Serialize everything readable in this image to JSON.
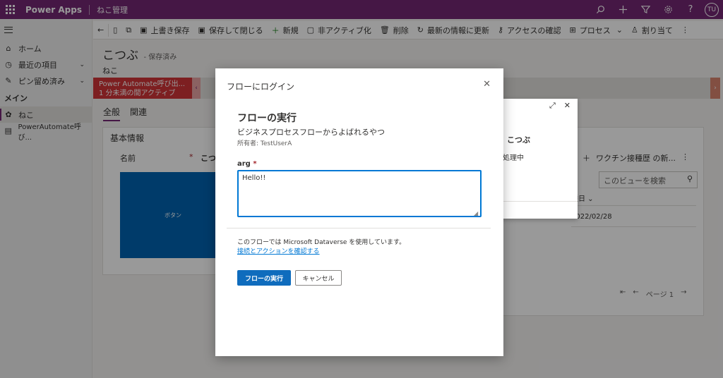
{
  "header": {
    "app_name": "Power Apps",
    "env_name": "ねこ管理",
    "avatar": "TU",
    "icons": [
      "search-icon",
      "plus-icon",
      "filter-icon",
      "gear-icon",
      "help-icon"
    ]
  },
  "nav": {
    "items": [
      {
        "label": "ホーム",
        "icon": "home-icon"
      },
      {
        "label": "最近の項目",
        "icon": "clock-icon"
      },
      {
        "label": "ピン留め済み",
        "icon": "pin-icon"
      }
    ],
    "section": "メイン",
    "entities": [
      {
        "label": "ねこ",
        "icon": "puzzle-icon"
      },
      {
        "label": "PowerAutomate呼び...",
        "icon": "document-icon"
      }
    ]
  },
  "commands": [
    {
      "label": "上書き保存",
      "icon": "save-icon"
    },
    {
      "label": "保存して閉じる",
      "icon": "save-close-icon"
    },
    {
      "label": "新規",
      "icon": "plus-icon"
    },
    {
      "label": "非アクティブ化",
      "icon": "deactivate-icon"
    },
    {
      "label": "削除",
      "icon": "trash-icon"
    },
    {
      "label": "最新の情報に更新",
      "icon": "refresh-icon"
    },
    {
      "label": "アクセスの確認",
      "icon": "key-icon"
    },
    {
      "label": "プロセス",
      "icon": "process-icon"
    },
    {
      "label": "割り当て",
      "icon": "person-icon"
    }
  ],
  "record": {
    "title": "こつぶ",
    "status": "- 保存済み",
    "entity": "ねこ"
  },
  "bpf": {
    "line1": "Power Automate呼び出...",
    "line2": "1 分未満の間アクティブ"
  },
  "tabs": [
    "全般",
    "関連"
  ],
  "section": {
    "title": "基本情報",
    "field_label": "名前",
    "field_required": "*",
    "field_value": "こつ",
    "button_label": "ボタン"
  },
  "subgrid": {
    "add_label": "ワクチン接種歴 の新...",
    "search_placeholder": "このビューを検索",
    "column_header": "種日",
    "cell_value": "2022/02/28",
    "page_label": "ページ 1"
  },
  "flyout": {
    "name": "こつぶ",
    "status": "処理中"
  },
  "dialog": {
    "header": "フローにログイン",
    "title": "フローの実行",
    "subtitle": "ビジネスプロセスフローからよばれるやつ",
    "owner": "所有者: TestUserA",
    "arg_label": "arg",
    "arg_required": "*",
    "arg_value": "Hello!!",
    "note": "このフローでは Microsoft Dataverse を使用しています。",
    "link": "接続とアクションを確認する",
    "run_button": "フローの実行",
    "cancel_button": "キャンセル"
  }
}
